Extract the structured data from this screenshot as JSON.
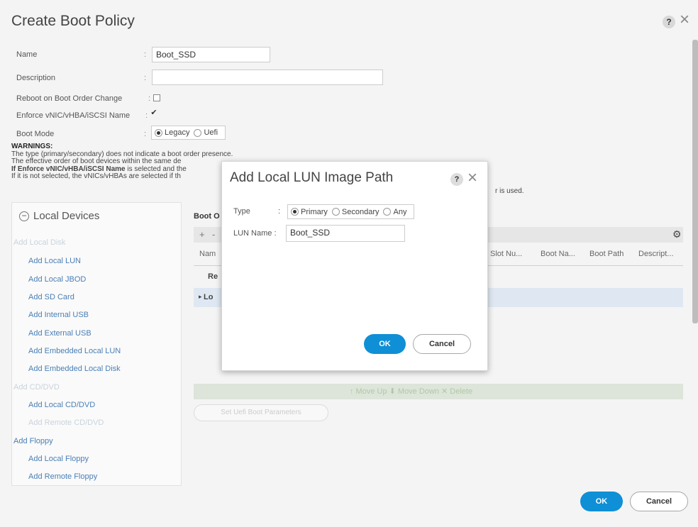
{
  "dialog": {
    "title": "Create Boot Policy",
    "help": "?",
    "close": "×"
  },
  "form": {
    "name_label": "Name",
    "name_value": "Boot_SSD",
    "description_label": "Description",
    "description_value": "",
    "reboot_label": "Reboot on Boot Order Change",
    "reboot_checked": false,
    "enforce_label": "Enforce vNIC/vHBA/iSCSI Name",
    "enforce_checked": true,
    "enforce_mark": "✔",
    "boot_mode_label": "Boot Mode",
    "boot_mode_options": [
      "Legacy",
      "Uefi"
    ],
    "boot_mode_selected": "Legacy",
    "colon": ":"
  },
  "warnings": {
    "heading": "WARNINGS:",
    "line1": "The type (primary/secondary) does not indicate a boot order presence.",
    "line2": "The effective order of boot devices within the same de",
    "line3_bold": "If Enforce vNIC/vHBA/iSCSI Name",
    "line3_rest": " is selected and the",
    "line4": "If it is not selected, the vNICs/vHBAs are selected if th",
    "line4_tail": "r is used."
  },
  "left_panel": {
    "header": "Local Devices",
    "collapse_icon": "−",
    "items": [
      {
        "label": "Add Local Disk",
        "kind": "cat"
      },
      {
        "label": "Add Local LUN",
        "kind": "sub"
      },
      {
        "label": "Add Local JBOD",
        "kind": "sub"
      },
      {
        "label": "Add SD Card",
        "kind": "sub"
      },
      {
        "label": "Add Internal USB",
        "kind": "sub"
      },
      {
        "label": "Add External USB",
        "kind": "sub"
      },
      {
        "label": "Add Embedded Local LUN",
        "kind": "sub"
      },
      {
        "label": "Add Embedded Local Disk",
        "kind": "sub"
      },
      {
        "label": "Add CD/DVD",
        "kind": "cat"
      },
      {
        "label": "Add Local CD/DVD",
        "kind": "sub"
      },
      {
        "label": "Add Remote CD/DVD",
        "kind": "dim"
      },
      {
        "label": "Add Floppy",
        "kind": "catblue"
      },
      {
        "label": "Add Local Floppy",
        "kind": "sub"
      },
      {
        "label": "Add Remote Floppy",
        "kind": "sub"
      }
    ]
  },
  "boot_order": {
    "heading_fragment": "Boot O",
    "toolbar_plus": "+",
    "toolbar_minus": "-",
    "gear": "⚙",
    "columns_visible": [
      "Nam",
      "Slot Nu...",
      "Boot Na...",
      "Boot Path",
      "Descript..."
    ],
    "row1_fragment": "Re",
    "row2_fragment": "Lo",
    "row2_arrow": "▸",
    "bottom_bar_text": "↑ Move Up  ⬇ Move Down  ✕ Delete",
    "set_uefi_button": "Set Uefi Boot Parameters"
  },
  "footer": {
    "ok": "OK",
    "cancel": "Cancel"
  },
  "modal": {
    "title": "Add Local LUN Image Path",
    "help": "?",
    "close": "×",
    "type_label": "Type",
    "type_options": [
      "Primary",
      "Secondary",
      "Any"
    ],
    "type_selected": "Primary",
    "lun_label": "LUN Name :",
    "lun_value": "Boot_SSD",
    "colon": ":",
    "ok": "OK",
    "cancel": "Cancel"
  },
  "colors": {
    "accent": "#0f8fd6",
    "link": "#4a7fb5"
  }
}
